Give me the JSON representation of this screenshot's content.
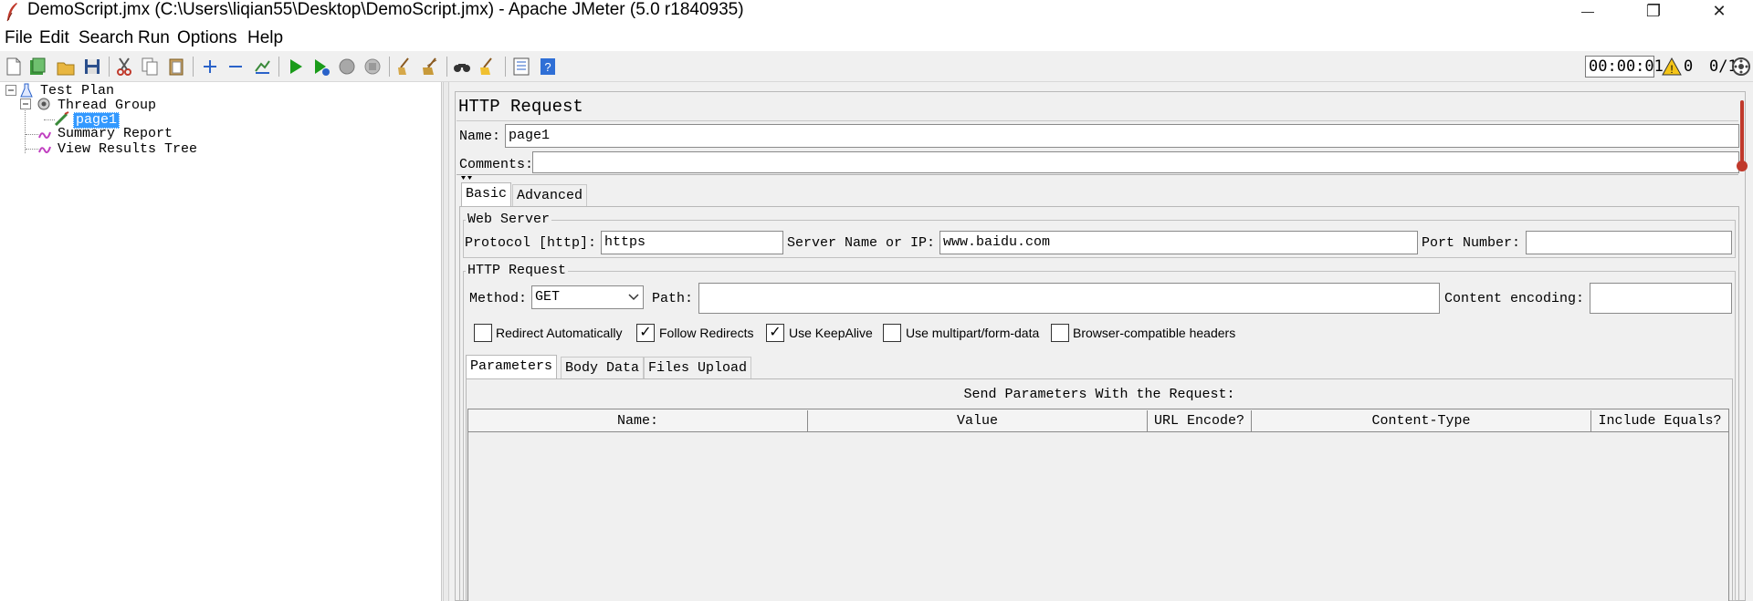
{
  "window": {
    "title": "DemoScript.jmx (C:\\Users\\liqian55\\Desktop\\DemoScript.jmx) - Apache JMeter (5.0 r1840935)",
    "minimize_glyph": "—",
    "restore_glyph": "❐",
    "close_glyph": "✕"
  },
  "menu": {
    "items": [
      "File",
      "Edit",
      "Search",
      "Run",
      "Options",
      "Help"
    ]
  },
  "toolbar": {
    "timer": "00:00:01",
    "warning_count": "0",
    "threads": "0/1",
    "icons": [
      "new-icon",
      "templates-icon",
      "open-icon",
      "save-icon",
      "cut-icon",
      "copy-icon",
      "paste-icon",
      "expand-icon",
      "collapse-icon",
      "toggle-icon",
      "start-icon",
      "start-no-pause-icon",
      "stop-icon",
      "shutdown-icon",
      "clear-icon",
      "clear-all-icon",
      "search-icon",
      "reset-search-icon",
      "function-helper-icon",
      "help-icon",
      "remote-icon"
    ]
  },
  "tree": {
    "items": [
      {
        "label": "Test Plan"
      },
      {
        "label": "Thread Group"
      },
      {
        "label": "page1"
      },
      {
        "label": "Summary Report"
      },
      {
        "label": "View Results Tree"
      }
    ]
  },
  "panel": {
    "title": "HTTP Request",
    "name_label": "Name:",
    "name_value": "page1",
    "comments_label": "Comments:",
    "tabs": [
      "Basic",
      "Advanced"
    ],
    "web_server": {
      "legend": "Web Server",
      "protocol_label": "Protocol [http]:",
      "protocol_value": "https",
      "server_label": "Server Name or IP:",
      "server_value": "www.baidu.com",
      "port_label": "Port Number:",
      "port_value": ""
    },
    "http_request": {
      "legend": "HTTP Request",
      "method_label": "Method:",
      "method_value": "GET",
      "path_label": "Path:",
      "path_value": "",
      "encoding_label": "Content encoding:",
      "encoding_value": ""
    },
    "checkboxes": [
      {
        "label": "Redirect Automatically",
        "checked": false
      },
      {
        "label": "Follow Redirects",
        "checked": true
      },
      {
        "label": "Use KeepAlive",
        "checked": true
      },
      {
        "label": "Use multipart/form-data",
        "checked": false
      },
      {
        "label": "Browser-compatible headers",
        "checked": false
      }
    ],
    "subtabs": [
      "Parameters",
      "Body Data",
      "Files Upload"
    ],
    "params_caption": "Send Parameters With the Request:",
    "table_headers": [
      "Name:",
      "Value",
      "URL Encode?",
      "Content-Type",
      "Include Equals?"
    ]
  },
  "colors": {
    "selection": "#3399ff",
    "run_green": "#1a9b1a",
    "help_blue": "#2f6fd6"
  }
}
